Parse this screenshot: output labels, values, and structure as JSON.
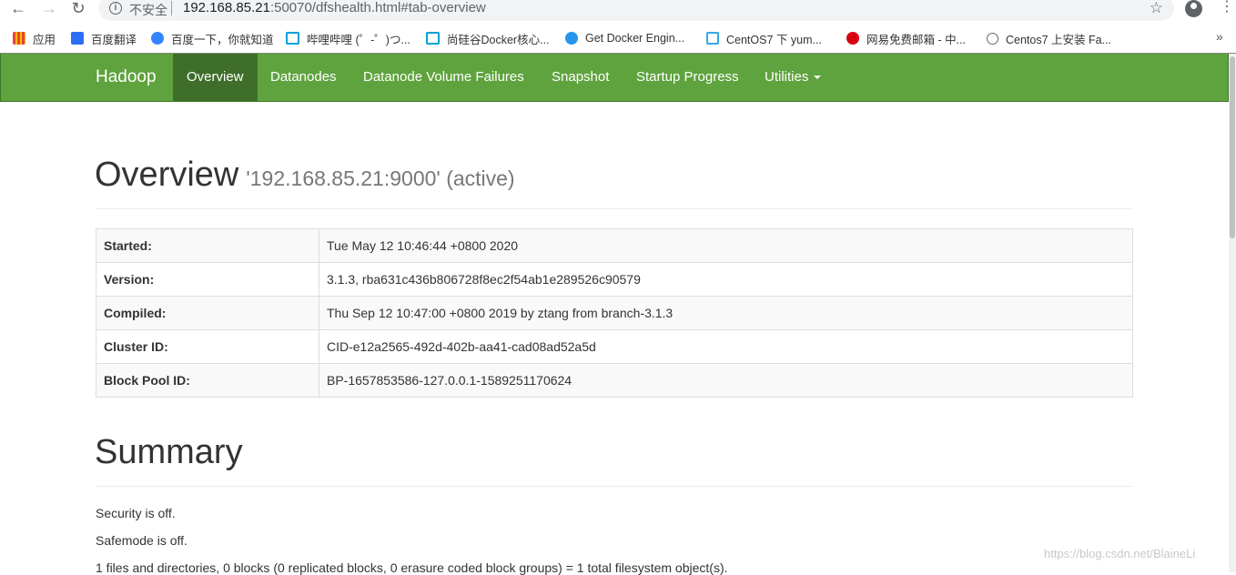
{
  "browser": {
    "insecure_label": "不安全",
    "url_host": "192.168.85.21",
    "url_rest": ":50070/dfshealth.html#tab-overview",
    "bookmarks": [
      {
        "label": "应用",
        "icon": "apps-grid-icon",
        "color": "#4285f4"
      },
      {
        "label": "百度翻译",
        "icon": "baidu-translate-icon",
        "color": "#2d6df6"
      },
      {
        "label": "百度一下，你就知道",
        "icon": "baidu-paw-icon",
        "color": "#3385ff"
      },
      {
        "label": "哔哩哔哩 (゜-゜)つ...",
        "icon": "bilibili-icon",
        "color": "#00a1d6"
      },
      {
        "label": "尚硅谷Docker核心...",
        "icon": "bilibili-icon",
        "color": "#00a1d6"
      },
      {
        "label": "Get Docker Engin...",
        "icon": "docker-icon",
        "color": "#2496ed"
      },
      {
        "label": "CentOS7 下 yum...",
        "icon": "csdn-box-icon",
        "color": "#35a7e8"
      },
      {
        "label": "网易免费邮箱 - 中...",
        "icon": "netease-mail-icon",
        "color": "#d7000f"
      },
      {
        "label": "Centos7 上安装 Fa...",
        "icon": "site-icon",
        "color": "#666666"
      }
    ],
    "more_label": "»"
  },
  "navbar": {
    "brand": "Hadoop",
    "items": [
      {
        "label": "Overview",
        "active": true
      },
      {
        "label": "Datanodes"
      },
      {
        "label": "Datanode Volume Failures"
      },
      {
        "label": "Snapshot"
      },
      {
        "label": "Startup Progress"
      },
      {
        "label": "Utilities"
      }
    ],
    "bg_color": "#5fa33e",
    "active_color": "#3f6e2a"
  },
  "overview": {
    "title": "Overview",
    "subtitle": "'192.168.85.21:9000' (active)",
    "rows": [
      {
        "key": "Started:",
        "value": "Tue May 12 10:46:44 +0800 2020"
      },
      {
        "key": "Version:",
        "value": "3.1.3, rba631c436b806728f8ec2f54ab1e289526c90579"
      },
      {
        "key": "Compiled:",
        "value": "Thu Sep 12 10:47:00 +0800 2019 by ztang from branch-3.1.3"
      },
      {
        "key": "Cluster ID:",
        "value": "CID-e12a2565-492d-402b-aa41-cad08ad52a5d"
      },
      {
        "key": "Block Pool ID:",
        "value": "BP-1657853586-127.0.0.1-1589251170624"
      }
    ]
  },
  "summary": {
    "title": "Summary",
    "lines": [
      "Security is off.",
      "Safemode is off.",
      "1 files and directories, 0 blocks (0 replicated blocks, 0 erasure coded block groups) = 1 total filesystem object(s)."
    ]
  },
  "watermark": "https://blog.csdn.net/BlaineLi"
}
